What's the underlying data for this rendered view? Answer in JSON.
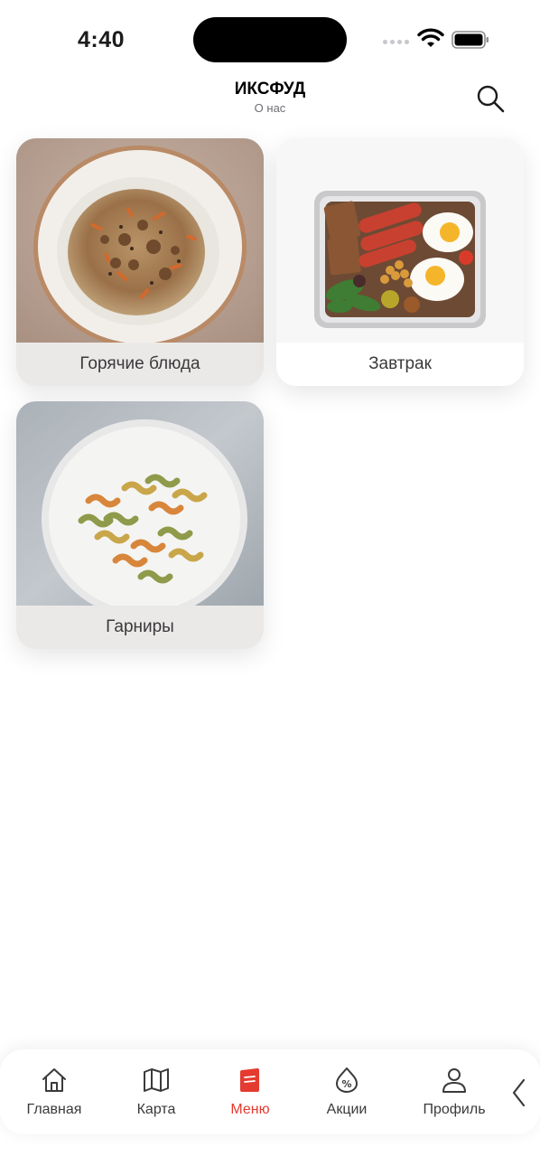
{
  "status": {
    "time": "4:40"
  },
  "header": {
    "title": "ИКСФУД",
    "subtitle": "О нас"
  },
  "categories": [
    {
      "label": "Горячие блюда",
      "image": "pilaf-plate"
    },
    {
      "label": "Завтрак",
      "image": "breakfast-box"
    },
    {
      "label": "Гарниры",
      "image": "fusilli-plate"
    }
  ],
  "tabs": [
    {
      "label": "Главная",
      "icon": "home-icon",
      "active": false
    },
    {
      "label": "Карта",
      "icon": "map-icon",
      "active": false
    },
    {
      "label": "Меню",
      "icon": "menu-icon",
      "active": true
    },
    {
      "label": "Акции",
      "icon": "discount-icon",
      "active": false
    },
    {
      "label": "Профиль",
      "icon": "profile-icon",
      "active": false
    }
  ],
  "colors": {
    "accent": "#e53a2f",
    "text": "#1c1c1e",
    "muted": "#6e6e73"
  }
}
